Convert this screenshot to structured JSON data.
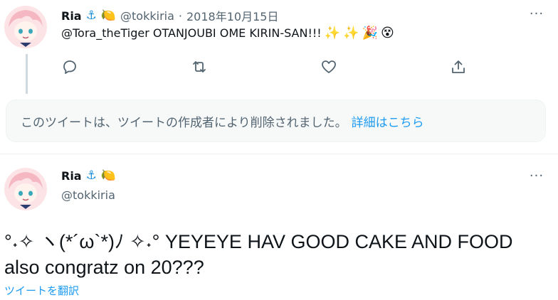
{
  "reply_tweet": {
    "author": {
      "name": "Ria",
      "badges": [
        "⚓",
        "🍋"
      ],
      "handle": "@tokkiria"
    },
    "separator": "·",
    "date": "2018年10月15日",
    "text": "@Tora_theTiger OTANJOUBI OME KIRIN-SAN!!!",
    "emojis": [
      "✨",
      "✨",
      "🎉",
      "😵"
    ],
    "more_label": "···",
    "actions": [
      "reply-icon",
      "retweet-icon",
      "like-icon",
      "share-icon"
    ]
  },
  "deleted_notice": {
    "text": "このツイートは、ツイートの作成者により削除されました。",
    "link": "詳細はこちら"
  },
  "main_tweet": {
    "author": {
      "name": "Ria",
      "badges": [
        "⚓",
        "🍋"
      ],
      "handle": "@tokkiria"
    },
    "more_label": "···",
    "text_line1": "°˖✧ ヽ(*´ω`*)ﾉ ✧˖° YEYEYE HAV GOOD CAKE AND FOOD",
    "text_line2": "also congratz on 20???",
    "translate": "ツイートを翻訳"
  },
  "colors": {
    "accent": "#1d9bf0",
    "muted": "#536471",
    "text": "#0f1419"
  }
}
